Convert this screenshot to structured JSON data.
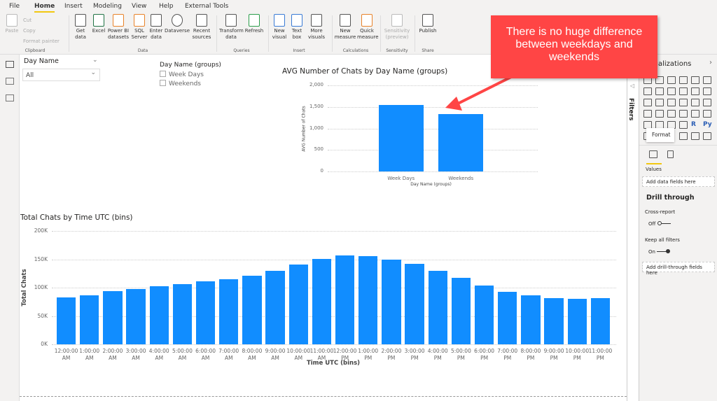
{
  "menu_tabs": [
    "File",
    "Home",
    "Insert",
    "Modeling",
    "View",
    "Help",
    "External Tools"
  ],
  "ribbon": {
    "clipboard": {
      "paste": "Paste",
      "cut": "Cut",
      "copy": "Copy",
      "format_painter": "Format painter",
      "group": "Clipboard"
    },
    "data": {
      "get_data": "Get data",
      "excel": "Excel",
      "power_bi": "Power BI datasets",
      "sql": "SQL Server",
      "enter": "Enter data",
      "dataverse": "Dataverse",
      "recent": "Recent sources",
      "group": "Data"
    },
    "queries": {
      "transform": "Transform data",
      "refresh": "Refresh",
      "group": "Queries"
    },
    "insert": {
      "new_visual": "New visual",
      "text_box": "Text box",
      "more_visuals": "More visuals",
      "group": "Insert"
    },
    "calculations": {
      "new_measure": "New measure",
      "quick_measure": "Quick measure",
      "group": "Calculations"
    },
    "sensitivity": {
      "label": "Sensitivity (preview)",
      "group": "Sensitivity"
    },
    "share": {
      "publish": "Publish",
      "group": "Share"
    }
  },
  "slicer": {
    "title": "Day Name",
    "value": "All"
  },
  "group_slicer": {
    "title": "Day Name (groups)",
    "options": [
      "Week Days",
      "Weekends"
    ]
  },
  "callout": "There is no huge difference between weekdays and weekends",
  "chart_data": [
    {
      "type": "bar",
      "title": "AVG Number of Chats by Day Name (groups)",
      "xlabel": "Day Name (groups)",
      "ylabel": "AVG Number of Chats",
      "categories": [
        "Week Days",
        "Weekends"
      ],
      "values": [
        1550,
        1330
      ],
      "ylim": [
        0,
        2000
      ],
      "yticks": [
        "0",
        "500",
        "1,000",
        "1,500",
        "2,000"
      ],
      "grid": true,
      "color": "#118dff"
    },
    {
      "type": "bar",
      "title": "Total Chats by Time UTC (bins)",
      "xlabel": "Time UTC (bins)",
      "ylabel": "Total Chats",
      "categories": [
        "12:00:00 AM",
        "1:00:00 AM",
        "2:00:00 AM",
        "3:00:00 AM",
        "4:00:00 AM",
        "5:00:00 AM",
        "6:00:00 AM",
        "7:00:00 AM",
        "8:00:00 AM",
        "9:00:00 AM",
        "10:00:00 AM",
        "11:00:00 AM",
        "12:00:00 PM",
        "1:00:00 PM",
        "2:00:00 PM",
        "3:00:00 PM",
        "4:00:00 PM",
        "5:00:00 PM",
        "6:00:00 PM",
        "7:00:00 PM",
        "8:00:00 PM",
        "9:00:00 PM",
        "10:00:00 PM",
        "11:00:00 PM"
      ],
      "values": [
        83000,
        87000,
        94000,
        98000,
        102000,
        106000,
        111000,
        115000,
        121000,
        130000,
        141000,
        151000,
        157000,
        155000,
        150000,
        142000,
        130000,
        117000,
        104000,
        93000,
        86000,
        81000,
        80000,
        81000
      ],
      "ylim": [
        0,
        200000
      ],
      "yticks": [
        "0K",
        "50K",
        "100K",
        "150K",
        "200K"
      ],
      "grid": true,
      "color": "#118dff"
    }
  ],
  "filters_label": "Filters",
  "viz_pane": {
    "title": "Visualizations",
    "tooltip": "Format",
    "values_label": "Values",
    "add_fields": "Add data fields here",
    "drill_title": "Drill through",
    "cross_report": "Cross-report",
    "cross_state": "Off",
    "keep_filters": "Keep all filters",
    "keep_state": "On",
    "add_drill": "Add drill-through fields here",
    "r_icon": "R",
    "py_icon": "Py"
  }
}
